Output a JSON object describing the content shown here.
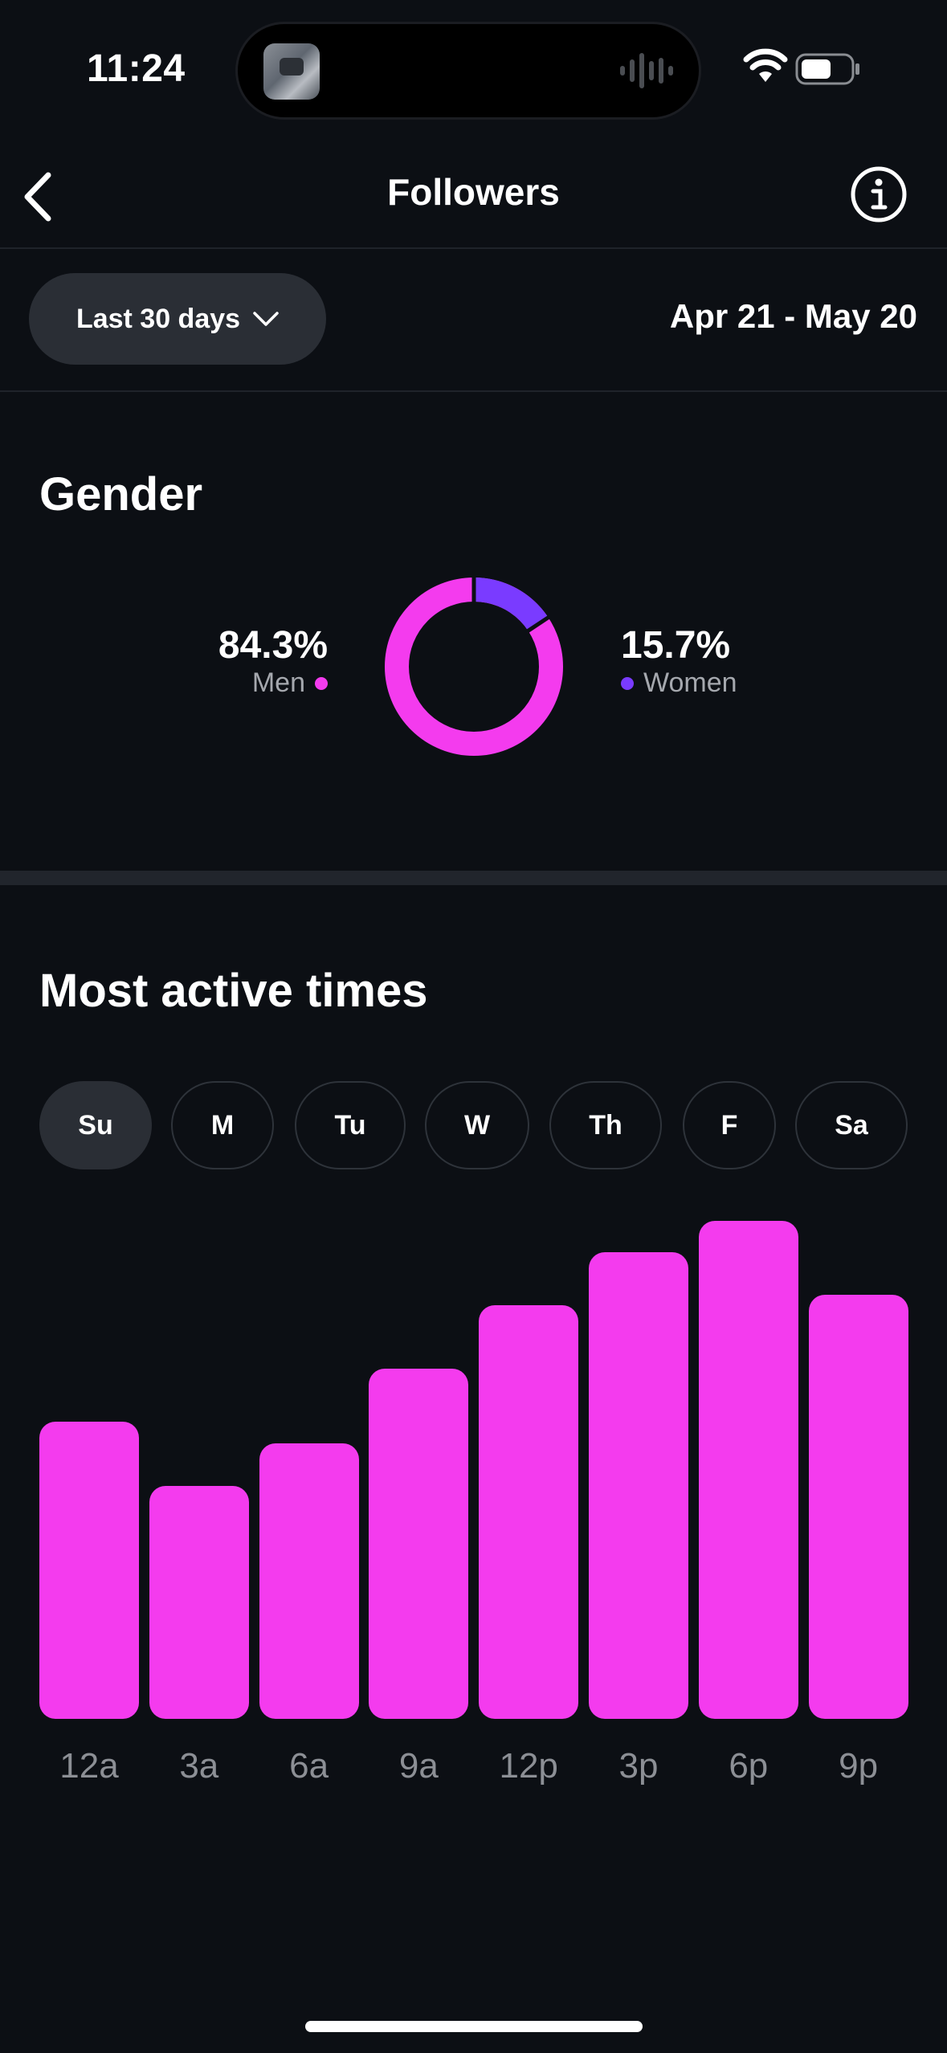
{
  "status_bar": {
    "time": "11:24"
  },
  "nav": {
    "title": "Followers"
  },
  "filter": {
    "range_label": "Last 30 days",
    "date_range": "Apr 21 - May 20"
  },
  "gender": {
    "title": "Gender",
    "men": {
      "pct": "84.3%",
      "label": "Men",
      "value": 84.3,
      "color": "#f43bee"
    },
    "women": {
      "pct": "15.7%",
      "label": "Women",
      "value": 15.7,
      "color": "#7a3bff"
    }
  },
  "active": {
    "title": "Most active times",
    "days": [
      "Su",
      "M",
      "Tu",
      "W",
      "Th",
      "F",
      "Sa"
    ],
    "selected_day": "Su"
  },
  "chart_data": {
    "type": "bar",
    "categories": [
      "12a",
      "3a",
      "6a",
      "9a",
      "12p",
      "3p",
      "6p",
      "9p"
    ],
    "values": [
      56,
      44,
      52,
      66,
      78,
      88,
      94,
      80
    ],
    "ylim": [
      0,
      100
    ],
    "color": "#f43bee",
    "grid": false
  }
}
